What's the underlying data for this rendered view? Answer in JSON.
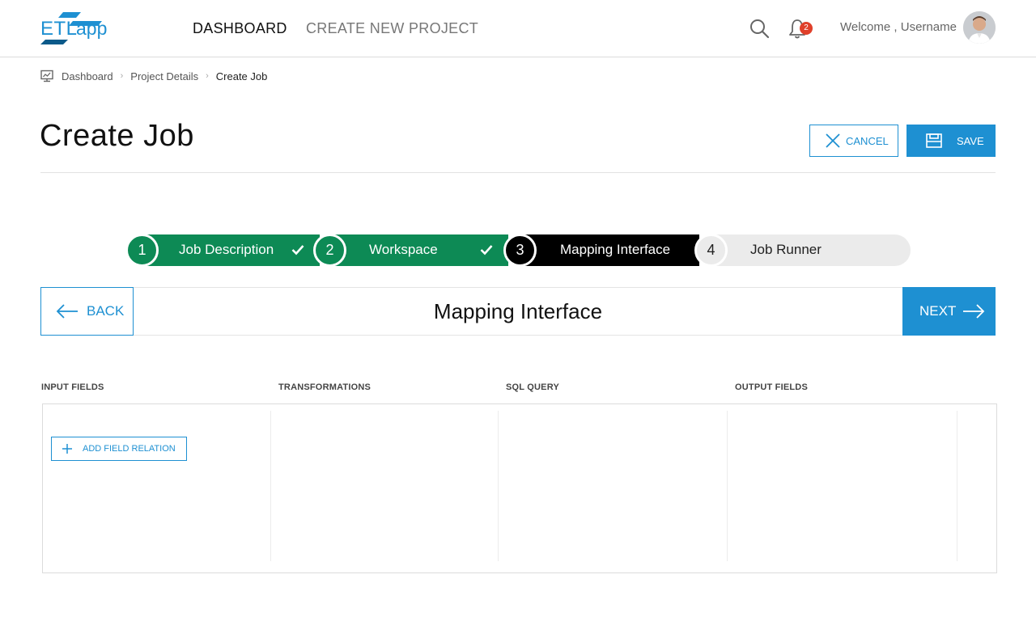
{
  "header": {
    "logo_text": "ETLapp",
    "nav": [
      {
        "label": "DASHBOARD",
        "active": true
      },
      {
        "label": "CREATE NEW PROJECT",
        "active": false
      }
    ],
    "notification_count": "2",
    "welcome_text": "Welcome , Username"
  },
  "breadcrumb": {
    "items": [
      "Dashboard",
      "Project Details",
      "Create Job"
    ],
    "separator": "›"
  },
  "page": {
    "title": "Create Job",
    "cancel_label": "CANCEL",
    "save_label": "SAVE"
  },
  "stepper": {
    "steps": [
      {
        "number": "1",
        "label": "Job Description",
        "status": "completed"
      },
      {
        "number": "2",
        "label": "Workspace",
        "status": "completed"
      },
      {
        "number": "3",
        "label": "Mapping Interface",
        "status": "active"
      },
      {
        "number": "4",
        "label": "Job Runner",
        "status": "pending"
      }
    ]
  },
  "panel": {
    "back_label": "BACK",
    "title": "Mapping Interface",
    "next_label": "NEXT"
  },
  "mapping": {
    "columns": [
      "INPUT FIELDS",
      "TRANSFORMATIONS",
      "SQL QUERY",
      "OUTPUT FIELDS"
    ],
    "add_relation_label": "ADD FIELD RELATION"
  },
  "colors": {
    "accent": "#1e90d2",
    "completed": "#0d8a55",
    "active": "#000000",
    "pending": "#ebebeb",
    "badge": "#e0402a"
  },
  "icons": {
    "search": "search-icon",
    "bell": "bell-icon",
    "dashboard": "monitor-chart-icon",
    "cancel": "close-icon",
    "save": "save-icon",
    "check": "check-icon",
    "back": "arrow-left-icon",
    "next": "arrow-right-icon",
    "add": "plus-icon"
  }
}
